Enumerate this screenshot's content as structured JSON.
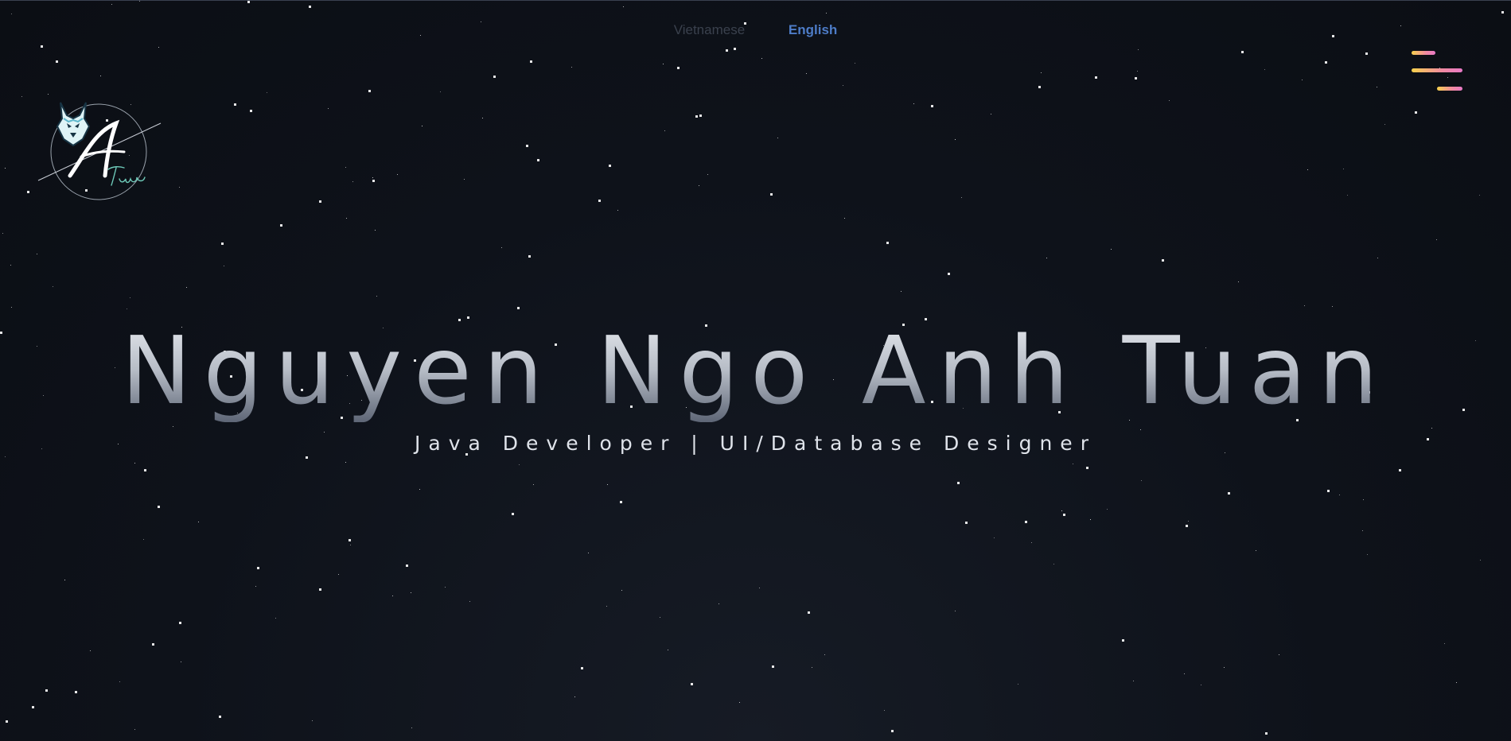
{
  "language_switch": {
    "vietnamese_label": "Vietnamese",
    "english_label": "English",
    "active": "English"
  },
  "logo": {
    "initial": "A",
    "signature": "Tuan"
  },
  "menu": {
    "icon": "hamburger-menu-icon"
  },
  "hero": {
    "name": "Nguyen Ngo Anh Tuan",
    "tagline": "Java Developer | UI/Database Designer"
  },
  "colors": {
    "background": "#0c1017",
    "active_language": "#4d7cc7",
    "inactive_language": "#3a414d",
    "menu_gradient_start": "#f7d14c",
    "menu_gradient_end": "#e879c7"
  }
}
